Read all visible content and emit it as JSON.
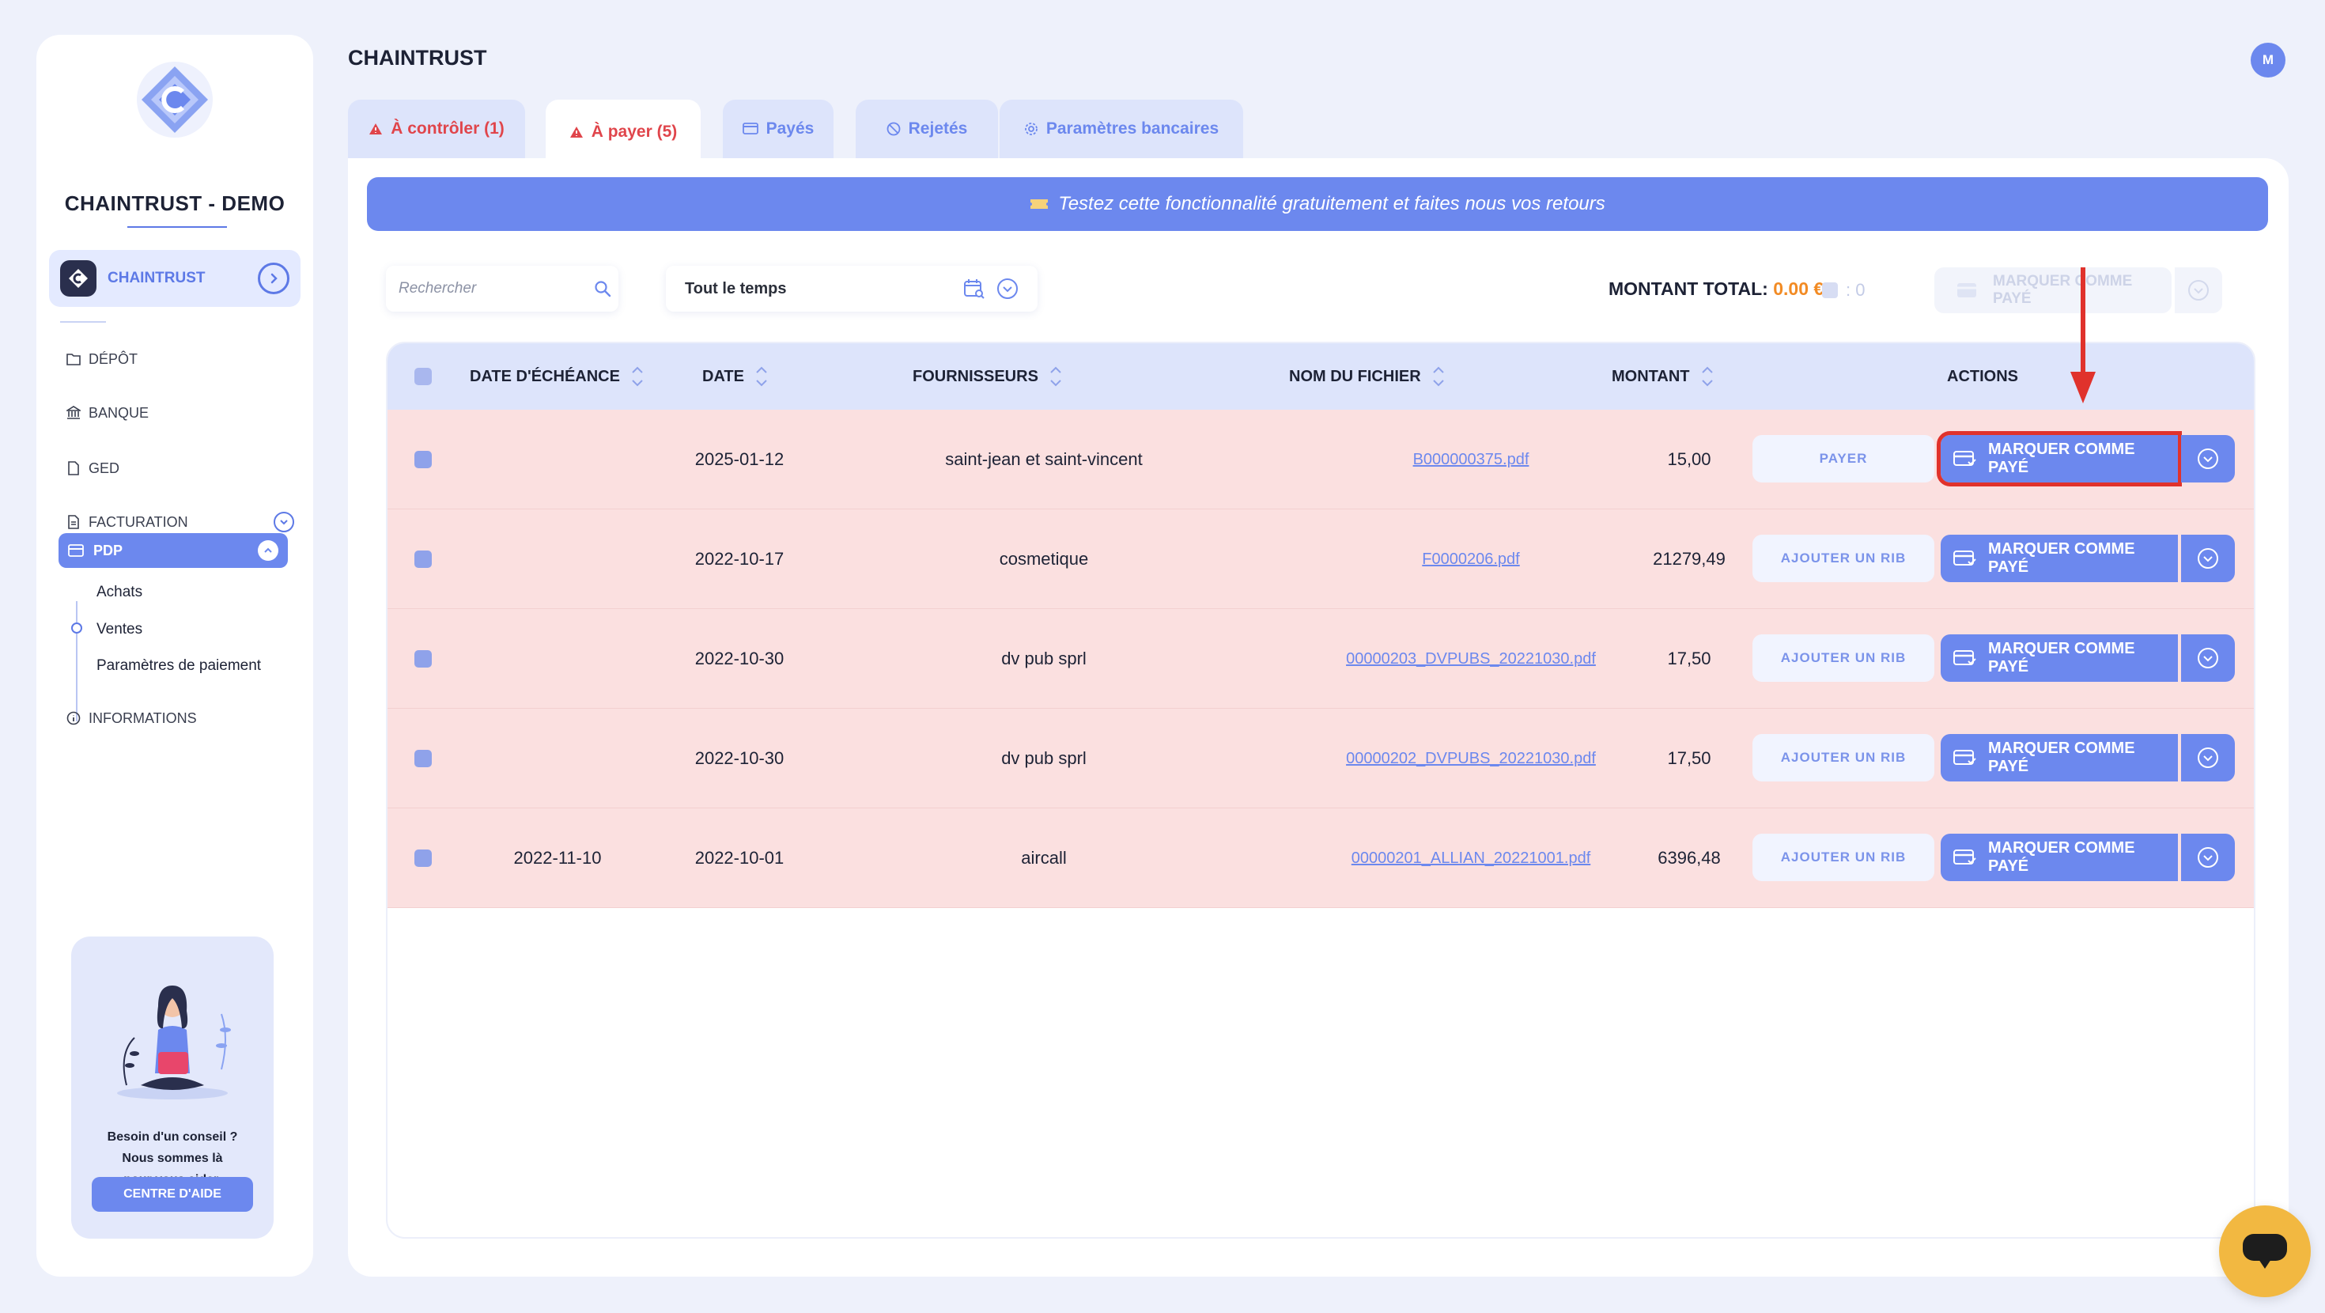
{
  "sidebar": {
    "brand": "CHAINTRUST - DEMO",
    "org_name": "CHAINTRUST",
    "nav": [
      {
        "label": "DÉPÔT",
        "icon": "folder-icon"
      },
      {
        "label": "BANQUE",
        "icon": "bank-icon"
      },
      {
        "label": "GED",
        "icon": "document-icon"
      },
      {
        "label": "FACTURATION",
        "icon": "invoice-icon"
      },
      {
        "label": "PDP",
        "icon": "card-icon"
      },
      {
        "label": "INFORMATIONS",
        "icon": "info-icon"
      }
    ],
    "pdp_subitems": [
      "Achats",
      "Ventes",
      "Paramètres de paiement"
    ],
    "help": {
      "line1": "Besoin d'un conseil ?",
      "line2": "Nous sommes là",
      "line3": "pour vous aider.",
      "button": "CENTRE D'AIDE"
    }
  },
  "header": {
    "title": "CHAINTRUST",
    "avatar": "M"
  },
  "tabs": [
    {
      "label": "À contrôler (1)",
      "icon": "warning-icon"
    },
    {
      "label": "À payer (5)",
      "icon": "warning-icon"
    },
    {
      "label": "Payés",
      "icon": "card-check-icon"
    },
    {
      "label": "Rejetés",
      "icon": "ban-icon"
    },
    {
      "label": "Paramètres bancaires",
      "icon": "gear-icon"
    }
  ],
  "banner": "Testez cette fonctionnalité gratuitement et faites nous vos retours",
  "toolbar": {
    "search_placeholder": "Rechercher",
    "period": "Tout le temps",
    "total_label": "MONTANT TOTAL:",
    "total_value": "0.00 €",
    "selected_count": ": 0",
    "bulk_button": "MARQUER COMME PAYÉ"
  },
  "table": {
    "columns": [
      "DATE D'ÉCHÉANCE",
      "DATE",
      "FOURNISSEURS",
      "NOM DU FICHIER",
      "MONTANT",
      "ACTIONS"
    ],
    "rows": [
      {
        "due": "",
        "date": "2025-01-12",
        "supplier": "saint-jean et saint-vincent",
        "file": "B000000375.pdf",
        "amount": "15,00",
        "action": "PAYER",
        "mark": "MARQUER COMME PAYÉ"
      },
      {
        "due": "",
        "date": "2022-10-17",
        "supplier": "cosmetique",
        "file": "F0000206.pdf",
        "amount": "21279,49",
        "action": "AJOUTER UN RIB",
        "mark": "MARQUER COMME PAYÉ"
      },
      {
        "due": "",
        "date": "2022-10-30",
        "supplier": "dv pub sprl",
        "file": "00000203_DVPUBS_20221030.pdf",
        "amount": "17,50",
        "action": "AJOUTER UN RIB",
        "mark": "MARQUER COMME PAYÉ"
      },
      {
        "due": "",
        "date": "2022-10-30",
        "supplier": "dv pub sprl",
        "file": "00000202_DVPUBS_20221030.pdf",
        "amount": "17,50",
        "action": "AJOUTER UN RIB",
        "mark": "MARQUER COMME PAYÉ"
      },
      {
        "due": "2022-11-10",
        "date": "2022-10-01",
        "supplier": "aircall",
        "file": "00000201_ALLIAN_20221001.pdf",
        "amount": "6396,48",
        "action": "AJOUTER UN RIB",
        "mark": "MARQUER COMME PAYÉ"
      }
    ]
  },
  "colors": {
    "accent": "#6c88ee",
    "row_highlight": "#fbe0e0",
    "warning": "#e0454b",
    "total": "#f28b24",
    "annotation": "#e0322c",
    "chat": "#f2b841"
  }
}
